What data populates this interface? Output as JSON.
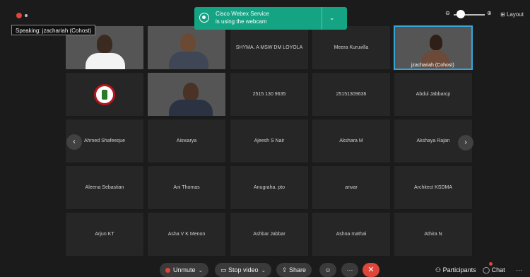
{
  "speaking_label": "Speaking: jzachariah (Cohost)",
  "notification": {
    "line1": "Cisco Webex Service",
    "line2": "is using the webcam",
    "icon": "webcam-icon"
  },
  "top_controls": {
    "zoom_out": "⊖",
    "zoom_in": "⊕",
    "layout_label": "Layout",
    "zoom_level": 0.15
  },
  "tiles": [
    {
      "name": "",
      "kind": "video"
    },
    {
      "name": "",
      "kind": "video"
    },
    {
      "name": "SHYMA. A MSW DM LOYOLA",
      "kind": "name"
    },
    {
      "name": "Meera Kuruvilla",
      "kind": "name"
    },
    {
      "name": "jzachariah  (Cohost)",
      "kind": "video-active"
    },
    {
      "name": "",
      "kind": "logo"
    },
    {
      "name": "",
      "kind": "video"
    },
    {
      "name": "2515 130 9635",
      "kind": "name"
    },
    {
      "name": "25151309636",
      "kind": "name"
    },
    {
      "name": "Abdul Jabbarcp",
      "kind": "name"
    },
    {
      "name": "Ahmed Shafeeque",
      "kind": "name"
    },
    {
      "name": "Aiswarya",
      "kind": "name"
    },
    {
      "name": "Ajeesh S Nair",
      "kind": "name"
    },
    {
      "name": "Akshara M",
      "kind": "name"
    },
    {
      "name": "Akshaya Rajan",
      "kind": "name"
    },
    {
      "name": "Aleena Sebastian",
      "kind": "name"
    },
    {
      "name": "Ani Thomas",
      "kind": "name"
    },
    {
      "name": "Anugraha. pto",
      "kind": "name"
    },
    {
      "name": "anvar",
      "kind": "name"
    },
    {
      "name": "Architect KSDMA",
      "kind": "name"
    },
    {
      "name": "Arjun KT",
      "kind": "name"
    },
    {
      "name": "Asha V K Menon",
      "kind": "name"
    },
    {
      "name": "Ashbar Jabbar",
      "kind": "name"
    },
    {
      "name": "Ashna mathai",
      "kind": "name"
    },
    {
      "name": "Athira N",
      "kind": "name"
    }
  ],
  "controls": {
    "unmute": "Unmute",
    "stop_video": "Stop video",
    "share": "Share",
    "participants": "Participants",
    "chat": "Chat",
    "more": "···",
    "end": "✕"
  },
  "colors": {
    "accent_toast": "#14a383",
    "end_red": "#e0453a",
    "active_border": "#36a6d8"
  }
}
